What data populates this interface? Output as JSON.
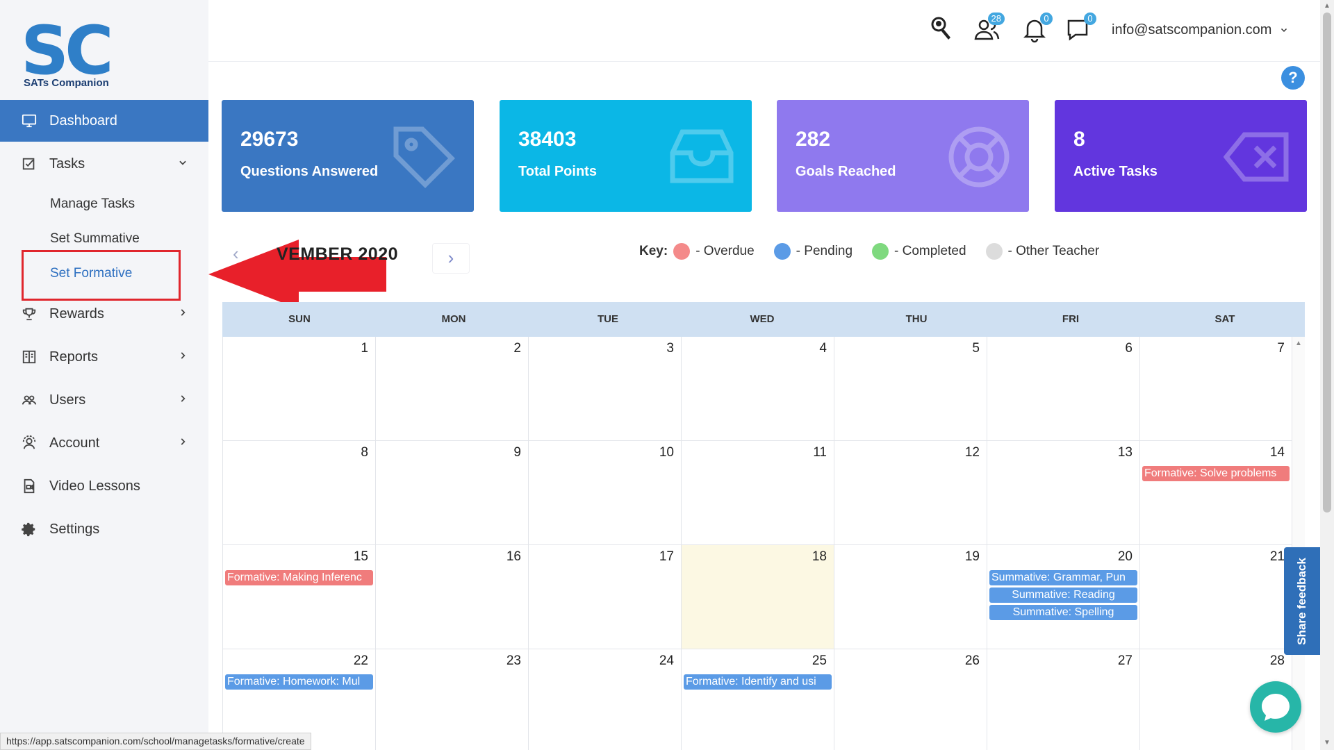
{
  "brand": {
    "logo_mark": "SC",
    "name": "SATs Companion"
  },
  "sidebar": {
    "items": [
      {
        "label": "Dashboard",
        "icon": "monitor-icon"
      },
      {
        "label": "Tasks",
        "icon": "tasks-icon"
      },
      {
        "label": "Rewards",
        "icon": "trophy-icon"
      },
      {
        "label": "Reports",
        "icon": "reports-icon"
      },
      {
        "label": "Users",
        "icon": "users-icon"
      },
      {
        "label": "Account",
        "icon": "account-icon"
      },
      {
        "label": "Video Lessons",
        "icon": "video-icon"
      },
      {
        "label": "Settings",
        "icon": "gear-icon"
      }
    ],
    "tasks_submenu": [
      "Manage Tasks",
      "Set Summative",
      "Set Formative"
    ]
  },
  "header": {
    "friends_count": "28",
    "notifications_count": "0",
    "messages_count": "0",
    "user_email": "info@satscompanion.com",
    "help_label": "?"
  },
  "stats": [
    {
      "value": "29673",
      "label": "Questions Answered",
      "color": "#3a77c2",
      "icon": "tag-icon"
    },
    {
      "value": "38403",
      "label": "Total Points",
      "color": "#0bb7e6",
      "icon": "inbox-icon"
    },
    {
      "value": "282",
      "label": "Goals Reached",
      "color": "#8f79ee",
      "icon": "lifebuoy-icon"
    },
    {
      "value": "8",
      "label": "Active Tasks",
      "color": "#6236de",
      "icon": "backspace-icon"
    }
  ],
  "calendar": {
    "title": "VEMBER 2020",
    "prev_label": "‹",
    "next_label": "›",
    "key_label": "Key:",
    "legend": [
      {
        "label": "- Overdue",
        "color": "#f48a8a"
      },
      {
        "label": "- Pending",
        "color": "#5b9be6"
      },
      {
        "label": "- Completed",
        "color": "#7fd97f"
      },
      {
        "label": "- Other Teacher",
        "color": "#dcdcdc"
      }
    ],
    "weekdays": [
      "SUN",
      "MON",
      "TUE",
      "WED",
      "THU",
      "FRI",
      "SAT"
    ],
    "weeks": [
      [
        "1",
        "2",
        "3",
        "4",
        "5",
        "6",
        "7"
      ],
      [
        "8",
        "9",
        "10",
        "11",
        "12",
        "13",
        "14"
      ],
      [
        "15",
        "16",
        "17",
        "18",
        "19",
        "20",
        "21"
      ],
      [
        "22",
        "23",
        "24",
        "25",
        "26",
        "27",
        "28"
      ]
    ],
    "events": {
      "d14": "Formative: Solve problems",
      "d15": "Formative: Making Inferenc",
      "d20a": "Summative: Grammar, Pun",
      "d20b": "Summative: Reading",
      "d20c": "Summative: Spelling",
      "d22": "Formative: Homework: Mul",
      "d25": "Formative: Identify and usi"
    }
  },
  "feedback_label": "Share feedback",
  "status_url": "https://app.satscompanion.com/school/managetasks/formative/create"
}
